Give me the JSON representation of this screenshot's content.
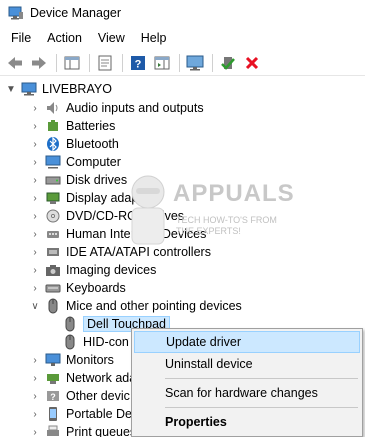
{
  "window": {
    "title": "Device Manager"
  },
  "menu": [
    "File",
    "Action",
    "View",
    "Help"
  ],
  "toolbar": {
    "buttons": [
      "back-icon",
      "forward-icon",
      "show-hide-console-tree-icon",
      "properties-icon",
      "help-icon",
      "action-pane-icon",
      "monitor-icon",
      "enable-device-icon",
      "uninstall-device-icon"
    ]
  },
  "tree": {
    "root": "LIVEBRAYO",
    "categories": [
      "Audio inputs and outputs",
      "Batteries",
      "Bluetooth",
      "Computer",
      "Disk drives",
      "Display adapters",
      "DVD/CD-ROM drives",
      "Human Interface Devices",
      "IDE ATA/ATAPI controllers",
      "Imaging devices",
      "Keyboards",
      "Mice and other pointing devices"
    ],
    "mice_children": [
      "Dell Touchpad",
      "HID-con"
    ],
    "after": [
      "Monitors",
      "Network ada",
      "Other devic",
      "Portable Dev",
      "Print queues"
    ]
  },
  "watermark": {
    "brand": "APPUALS",
    "tagline_1": "TECH HOW-TO'S FROM",
    "tagline_2": "THE EXPERTS!"
  },
  "context_menu": {
    "update": "Update driver",
    "uninstall": "Uninstall device",
    "scan": "Scan for hardware changes",
    "properties": "Properties"
  },
  "colors": {
    "selection": "#cce8ff",
    "selection_border": "#99d1ff",
    "menu_bg": "#f2f2f2",
    "delete_red": "#e81123",
    "help_blue": "#1e5aa8"
  }
}
